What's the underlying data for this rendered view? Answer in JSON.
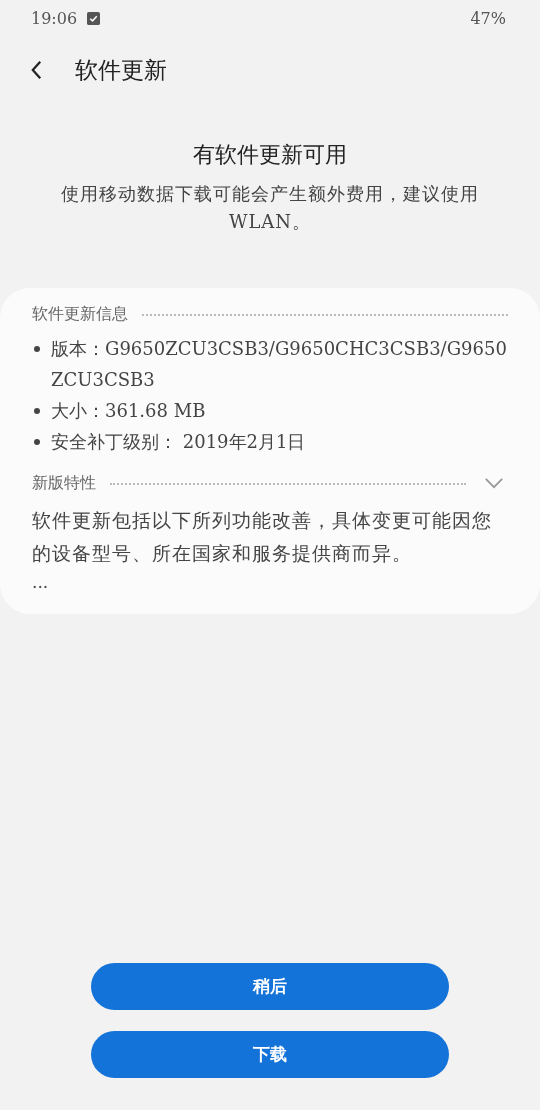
{
  "status_bar": {
    "time": "19:06",
    "battery": "47%"
  },
  "header": {
    "title": "软件更新"
  },
  "notice": {
    "title": "有软件更新可用",
    "message": "使用移动数据下载可能会产生额外费用，建议使用 WLAN。"
  },
  "info_section": {
    "title": "软件更新信息",
    "items": [
      "版本：G9650ZCU3CSB3/G9650CHC3CSB3/G9650ZCU3CSB3",
      "大小：361.68 MB",
      "安全补丁级别： 2019年2月1日"
    ]
  },
  "features_section": {
    "title": "新版特性",
    "expanded": false,
    "text": "软件更新包括以下所列功能改善，具体变更可能因您的设备型号、所在国家和服务提供商而异。",
    "more": "..."
  },
  "buttons": [
    "稍后",
    "下载"
  ]
}
